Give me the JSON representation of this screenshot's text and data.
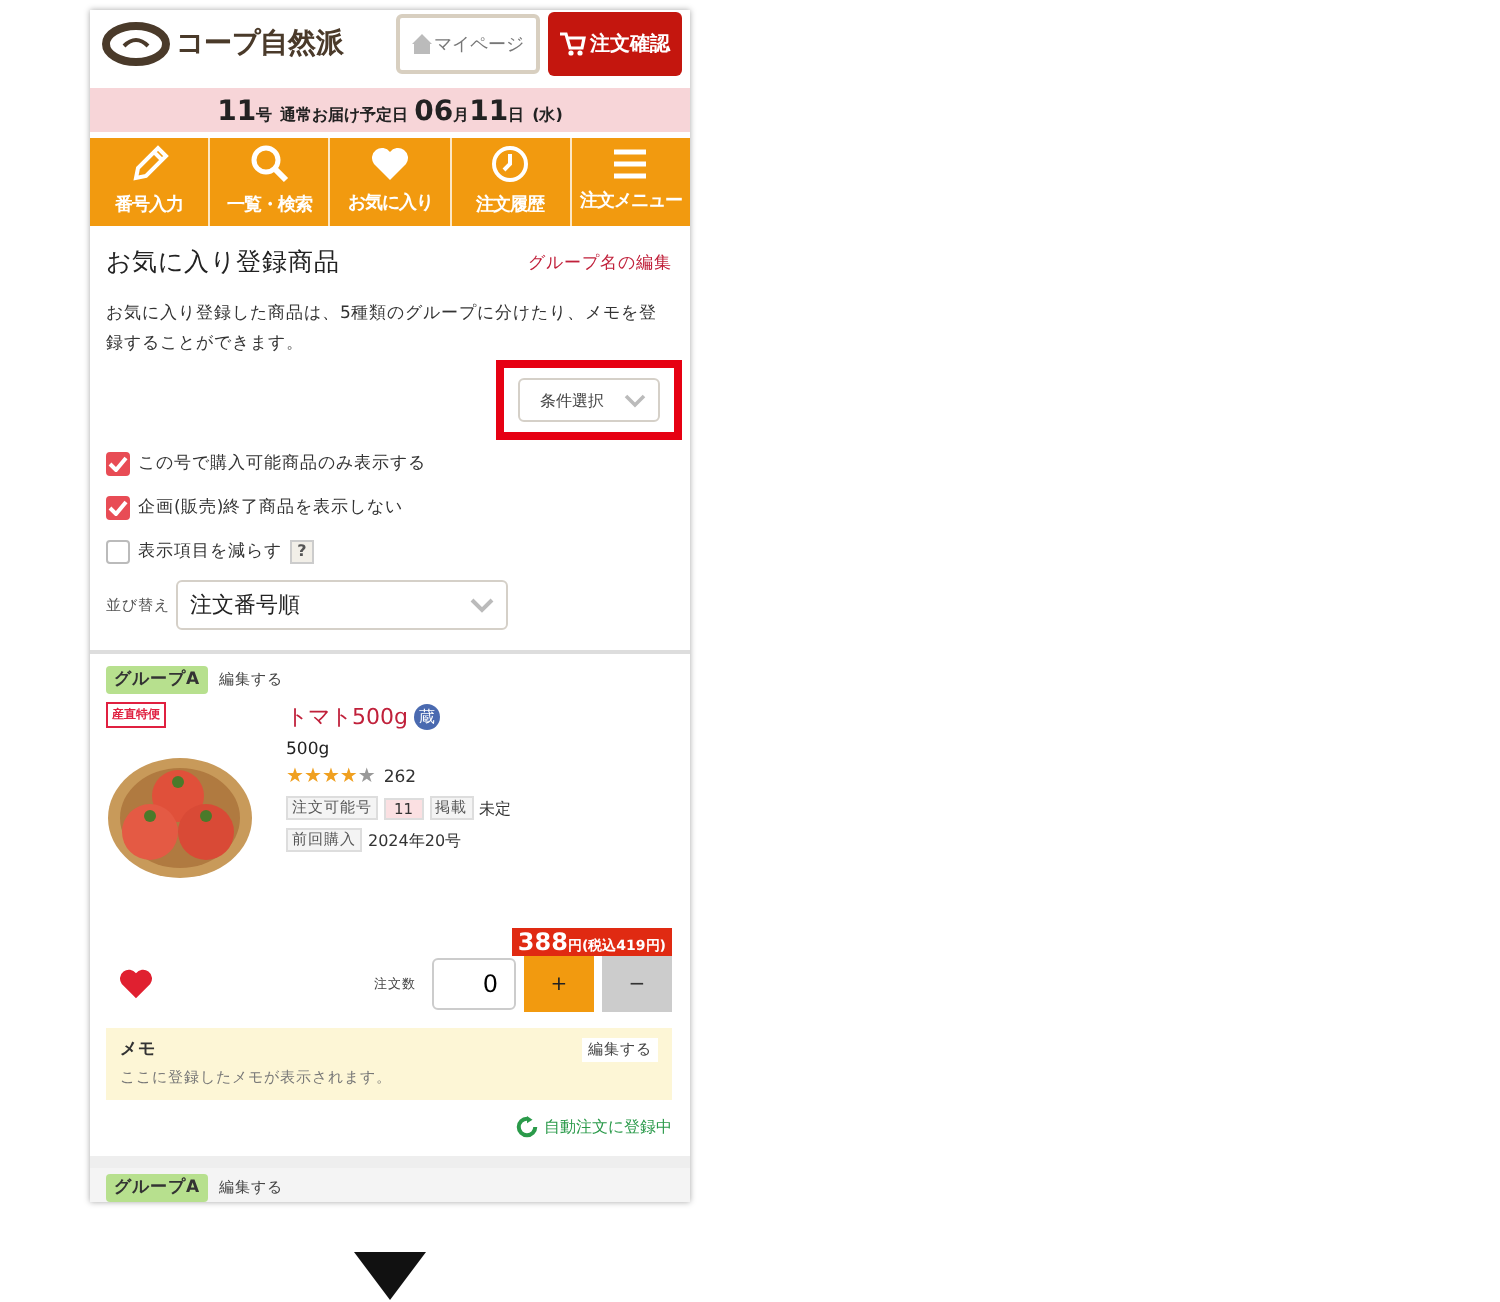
{
  "header": {
    "logo": "コープ自然派",
    "mypage_button": "マイページ",
    "order_button": "注文確認"
  },
  "delivery_bar": {
    "issue": "11",
    "issue_unit": "号",
    "label": "通常お届け予定日",
    "month": "06",
    "month_unit": "月",
    "day": "11",
    "day_unit": "日",
    "weekday": "(水)"
  },
  "nav": [
    {
      "label": "番号入力",
      "kind": "pencil"
    },
    {
      "label": "一覧・検索",
      "kind": "search"
    },
    {
      "label": "お気に入り",
      "kind": "heart"
    },
    {
      "label": "注文履歴",
      "kind": "clock"
    },
    {
      "label": "注文メニュー",
      "kind": "menu"
    }
  ],
  "section": {
    "title": "お気に入り登録商品",
    "edit_link": "グループ名の編集",
    "description": "お気に入り登録した商品は、5種類のグループに分けたり、メモを登録することができます。",
    "filter_button": "条件選択",
    "highlighted": true
  },
  "options": [
    {
      "label": "この号で購入可能商品のみ表示する",
      "checked": true
    },
    {
      "label": "企画(販売)終了商品を表示しない",
      "checked": true
    },
    {
      "label": "表示項目を減らす",
      "checked": false,
      "help_text": "?"
    }
  ],
  "sort": {
    "label": "並び替え",
    "value": "注文番号順"
  },
  "items": [
    {
      "group": "グループA",
      "group_edit": "編集する",
      "badge": "産直特便",
      "name": "トマト500g",
      "storage": "蔵",
      "size": "500g",
      "stars": 4,
      "reviews": "262",
      "issue_label": "注文可能号",
      "issue": "11",
      "listing_label": "掲載",
      "listing": "未定",
      "last_label": "前回購入",
      "last": "2024年20号",
      "price": "388",
      "price_unit": "円(税込419円)",
      "favorite": true,
      "qty_label": "注文数",
      "qty": "0",
      "plus": "+",
      "minus": "−",
      "memo_title": "メモ",
      "memo_edit": "編集する",
      "memo_text": "ここに登録したメモが表示されます。",
      "auto_order": "自動注文に登録中"
    }
  ],
  "next_item": {
    "group": "グループA",
    "group_edit": "編集する"
  }
}
